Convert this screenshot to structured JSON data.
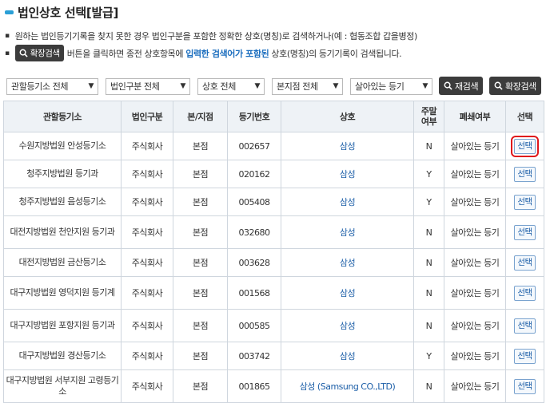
{
  "page": {
    "title": "법인상호 선택[발급]",
    "desc1": "원하는 법인등기기록을 찾지 못한 경우 법인구분을 포함한 정확한 상호(명칭)로 검색하거나(예 : 협동조합 갑을병정)",
    "desc2_btn": "확장검색",
    "desc2_pre": "버튼을 클릭하면 종전 상호항목에",
    "desc2_emph": "입력한 검색어가 포함된",
    "desc2_post": "상호(명칭)의 등기기록이 검색됩니다."
  },
  "filters": {
    "registry": "관할등기소 전체",
    "corp_type": "법인구분 전체",
    "company": "상호 전체",
    "branch": "본지점 전체",
    "status": "살아있는 등기",
    "research_btn": "재검색",
    "extended_btn": "확장검색"
  },
  "table": {
    "headers": {
      "registry": "관할등기소",
      "corp_type": "법인구분",
      "branch": "본/지점",
      "reg_no": "등기번호",
      "company": "상호",
      "main_a": "주말",
      "main_b": "여부",
      "closed": "폐쇄여부",
      "select": "선택"
    },
    "rows": [
      {
        "registry": "수원지방법원 안성등기소",
        "corp_type": "주식회사",
        "branch": "본점",
        "reg_no": "002657",
        "company": "삼성",
        "main": "N",
        "closed": "살아있는 등기",
        "select": "선택"
      },
      {
        "registry": "청주지방법원 등기과",
        "corp_type": "주식회사",
        "branch": "본점",
        "reg_no": "020162",
        "company": "삼성",
        "main": "Y",
        "closed": "살아있는 등기",
        "select": "선택"
      },
      {
        "registry": "청주지방법원 음성등기소",
        "corp_type": "주식회사",
        "branch": "본점",
        "reg_no": "005408",
        "company": "삼성",
        "main": "Y",
        "closed": "살아있는 등기",
        "select": "선택"
      },
      {
        "registry": "대전지방법원 천안지원 등기과",
        "corp_type": "주식회사",
        "branch": "본점",
        "reg_no": "032680",
        "company": "삼성",
        "main": "N",
        "closed": "살아있는 등기",
        "select": "선택"
      },
      {
        "registry": "대전지방법원 금산등기소",
        "corp_type": "주식회사",
        "branch": "본점",
        "reg_no": "003628",
        "company": "삼성",
        "main": "N",
        "closed": "살아있는 등기",
        "select": "선택"
      },
      {
        "registry": "대구지방법원 영덕지원 등기계",
        "corp_type": "주식회사",
        "branch": "본점",
        "reg_no": "001568",
        "company": "삼성",
        "main": "N",
        "closed": "살아있는 등기",
        "select": "선택"
      },
      {
        "registry": "대구지방법원 포항지원 등기과",
        "corp_type": "주식회사",
        "branch": "본점",
        "reg_no": "000585",
        "company": "삼성",
        "main": "N",
        "closed": "살아있는 등기",
        "select": "선택"
      },
      {
        "registry": "대구지방법원 경산등기소",
        "corp_type": "주식회사",
        "branch": "본점",
        "reg_no": "003742",
        "company": "삼성",
        "main": "Y",
        "closed": "살아있는 등기",
        "select": "선택"
      },
      {
        "registry": "대구지방법원 서부지원 고령등기소",
        "corp_type": "주식회사",
        "branch": "본점",
        "reg_no": "001865",
        "company": "삼성 (Samsung CO.,LTD)",
        "main": "N",
        "closed": "살아있는 등기",
        "select": "선택"
      }
    ]
  },
  "colors": {
    "accent": "#2a9fd6",
    "link": "#1d5fa8",
    "emphasis": "#1d6fbf",
    "highlight": "#e0171b"
  }
}
